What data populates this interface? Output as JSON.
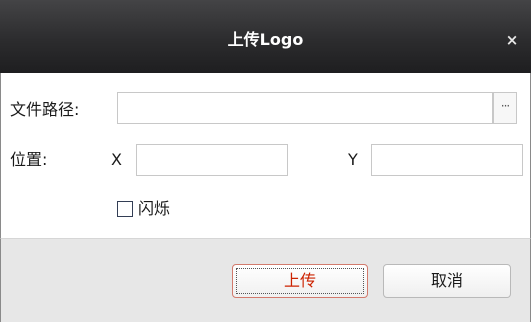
{
  "dialog": {
    "title": "上传Logo",
    "close_symbol": "×",
    "close_icon": "close-icon"
  },
  "form": {
    "file_path_label": "文件路径:",
    "file_path_value": "",
    "browse_label": "···",
    "position_label": "位置:",
    "x_label": "X",
    "x_value": "",
    "y_label": "Y",
    "y_value": "",
    "blink_label": "闪烁",
    "blink_checked": false
  },
  "buttons": {
    "upload_label": "上传",
    "cancel_label": "取消"
  },
  "colors": {
    "title_bar": "#2c2c2e",
    "upload_text": "#cc2200",
    "footer_bg": "#e7e7e7"
  }
}
